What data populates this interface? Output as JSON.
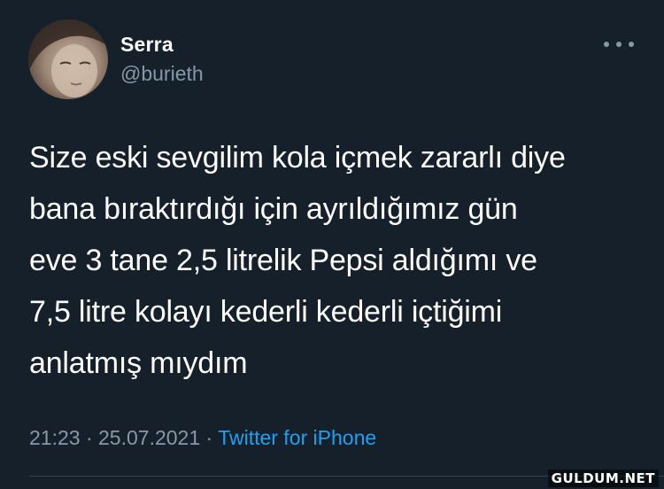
{
  "author": {
    "display_name": "Serra",
    "handle": "@burieth"
  },
  "tweet": {
    "text": "Size eski sevgilim kola içmek zararlı diye\nbana bıraktırdığı için ayrıldığımız gün\neve 3 tane 2,5 litrelik Pepsi aldığımı ve\n7,5 litre kolayı kederli kederli içtiğimi\nanlatmış mıydım",
    "time": "21:23",
    "separator": "·",
    "date": "25.07.2021",
    "source": "Twitter for iPhone"
  },
  "icons": {
    "more": "more-horizontal-icon"
  },
  "watermark": "GULDUM.NET",
  "colors": {
    "background": "#15202b",
    "text": "#ffffff",
    "secondary": "#8899a6",
    "accent": "#1da1f2"
  }
}
